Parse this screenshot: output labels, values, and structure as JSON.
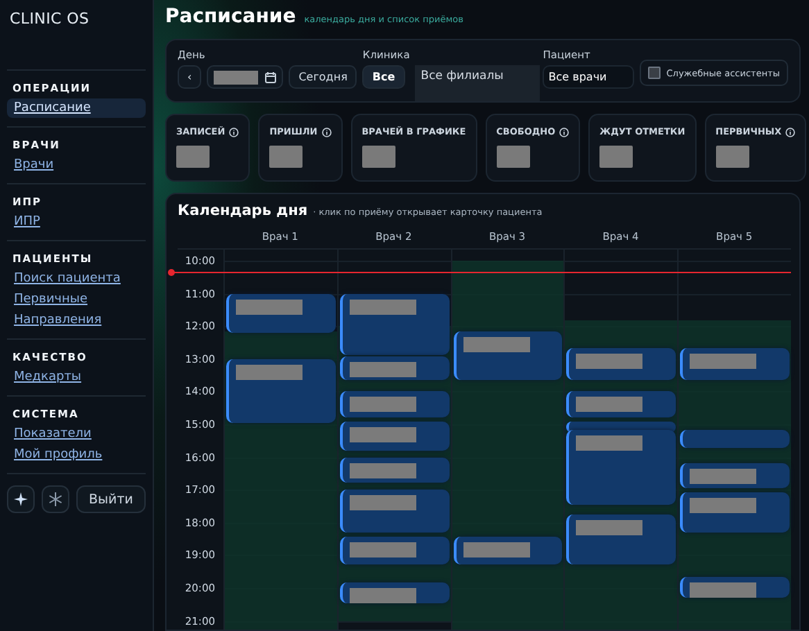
{
  "sidebar": {
    "logo": "CLINIC OS",
    "sections": [
      {
        "title": "ОПЕРАЦИИ",
        "items": [
          {
            "label": "Расписание",
            "selected": true
          }
        ]
      },
      {
        "title": "ВРАЧИ",
        "items": [
          {
            "label": "Врачи",
            "selected": false
          }
        ]
      },
      {
        "title": "ИПР",
        "items": [
          {
            "label": "ИПР",
            "selected": false
          }
        ]
      },
      {
        "title": "ПАЦИЕНТЫ",
        "items": [
          {
            "label": "Поиск пациента",
            "selected": false
          },
          {
            "label": "Первичные",
            "selected": false
          },
          {
            "label": "Направления",
            "selected": false
          }
        ]
      },
      {
        "title": "КАЧЕСТВО",
        "items": [
          {
            "label": "Медкарты",
            "selected": false
          }
        ]
      },
      {
        "title": "СИСТЕМА",
        "items": [
          {
            "label": "Показатели",
            "selected": false
          },
          {
            "label": "Мой профиль",
            "selected": false
          }
        ]
      }
    ],
    "logout": "Выйти"
  },
  "page": {
    "title": "Расписание",
    "subtitle": "календарь дня и список приёмов"
  },
  "filters": {
    "day_label": "День",
    "prev": "‹",
    "today": "Сегодня",
    "clinic_label": "Клиника",
    "clinic_all": "Все",
    "clinic_value": "Все филиалы",
    "patient_label": "Пациент",
    "patient_value": "Все врачи",
    "assistants": {
      "label": "Служебные ассистенты",
      "checked": false
    }
  },
  "stats": [
    {
      "label": "ЗАПИСЕЙ",
      "help": true
    },
    {
      "label": "ПРИШЛИ",
      "help": true
    },
    {
      "label": "ВРАЧЕЙ В ГРАФИКЕ",
      "help": false
    },
    {
      "label": "СВОБОДНО",
      "help": true
    },
    {
      "label": "ЖДУТ ОТМЕТКИ",
      "help": false
    },
    {
      "label": "ПЕРВИЧНЫХ",
      "help": true
    }
  ],
  "calendar": {
    "title": "Календарь дня",
    "hint": "· клик по приёму открывает карточку пациента",
    "hours": [
      "10:00",
      "11:00",
      "12:00",
      "13:00",
      "14:00",
      "15:00",
      "16:00",
      "17:00",
      "18:00",
      "19:00",
      "20:00",
      "21:00"
    ],
    "doctors": [
      {
        "name": "Врач 1"
      },
      {
        "name": "Врач 2"
      },
      {
        "name": "Врач 3"
      },
      {
        "name": "Врач 4"
      },
      {
        "name": "Врач 5"
      }
    ]
  }
}
